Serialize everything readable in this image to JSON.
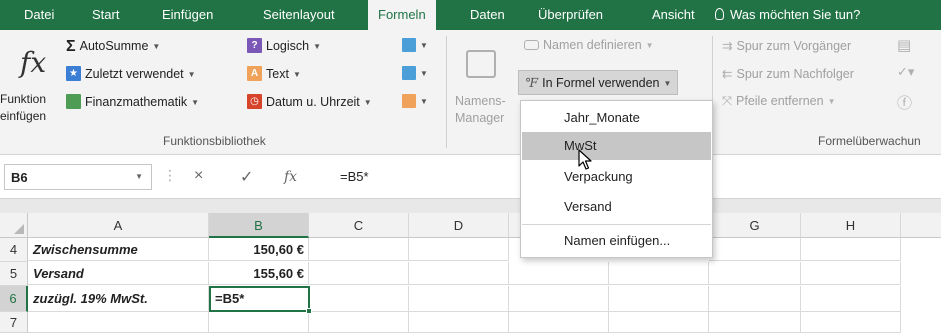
{
  "tabs": [
    "Datei",
    "Start",
    "Einfügen",
    "Seitenlayout",
    "Formeln",
    "Daten",
    "Überprüfen",
    "Ansicht"
  ],
  "active_tab": "Formeln",
  "tell_me": "Was möchten Sie tun?",
  "ribbon": {
    "insert_function": {
      "line1": "Funktion",
      "line2": "einfügen"
    },
    "autosum": "AutoSumme",
    "recent": "Zuletzt verwendet",
    "financial": "Finanzmathematik",
    "logical": "Logisch",
    "text": "Text",
    "datetime": "Datum u. Uhrzeit",
    "function_library_label": "Funktionsbibliothek",
    "name_manager": {
      "line1": "Namens-",
      "line2": "Manager"
    },
    "define_name": "Namen definieren",
    "use_in_formula": "In Formel verwenden",
    "trace_precedents": "Spur zum Vorgänger",
    "trace_dependents": "Spur zum Nachfolger",
    "remove_arrows": "Pfeile entfernen",
    "formula_auditing_label": "Formelüberwachun"
  },
  "formula_bar": {
    "name_box": "B6",
    "cancel_symbol": "×",
    "enter_symbol": "✓",
    "fx_symbol": "fx",
    "formula": "=B5*"
  },
  "dropdown_items": [
    "Jahr_Monate",
    "MwSt",
    "Verpackung",
    "Versand",
    "Namen einfügen..."
  ],
  "dropdown_highlighted": "MwSt",
  "columns": [
    "A",
    "B",
    "C",
    "D",
    "E",
    "F",
    "G",
    "H"
  ],
  "rows": [
    {
      "num": "4",
      "a": "Zwischensumme",
      "b": "150,60 €"
    },
    {
      "num": "5",
      "a": "Versand",
      "b": "155,60 €"
    },
    {
      "num": "6",
      "a": "zuzügl. 19% MwSt.",
      "b": "=B5*"
    },
    {
      "num": "7",
      "a": "",
      "b": ""
    }
  ],
  "active_cell": "B6",
  "colors": {
    "excel_green": "#217346",
    "ribbon_bg": "#f3f3f3",
    "highlight": "#c6c6c6"
  }
}
